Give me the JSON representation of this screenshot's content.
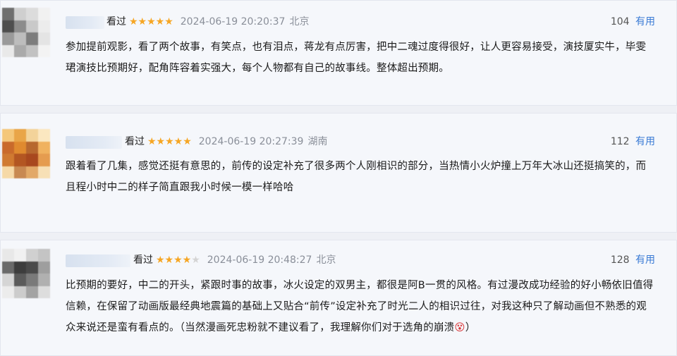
{
  "reviews": [
    {
      "watched_label": "看过",
      "stars": "★★★★★",
      "stars_empty": "",
      "datetime": "2024-06-19 20:20:37",
      "location": "北京",
      "useful_count": "104",
      "useful_label": "有用",
      "text": "参加提前观影，看了两个故事，有笑点，也有泪点，蒋龙有点厉害，把中二魂过度得很好，让人更容易接受，演技厦实牛，毕雯珺演技比预期好，配角阵容着实强大，每个人物都有自己的故事线。整体超出预期。",
      "avatar_colors": [
        "#6f6f6f",
        "#cfcfcf",
        "#dcdcdc",
        "#f1f1f1",
        "#4e4e4e",
        "#8c8c8c",
        "#c9c9c9",
        "#ececec",
        "#9a9a9a",
        "#bdbdbd",
        "#7d7d7d",
        "#e4e4e4",
        "#e9e9e9",
        "#aaaaaa",
        "#c2c2c2",
        "#f3f3f3"
      ]
    },
    {
      "watched_label": "看过",
      "stars": "★★★★★",
      "stars_empty": "",
      "datetime": "2024-06-19 20:27:39",
      "location": "湖南",
      "useful_count": "112",
      "useful_label": "有用",
      "text": "跟着看了几集，感觉还挺有意思的，前传的设定补充了很多两个人刚相识的部分，当热情小火炉撞上万年大冰山还挺搞笑的，而且程小时中二的样子简直跟我小时候一模一样哈哈",
      "avatar_colors": [
        "#f4c77a",
        "#e9a548",
        "#f3d39a",
        "#fbe7c0",
        "#c96a2b",
        "#e08a2f",
        "#b7682f",
        "#f0b25f",
        "#d07a31",
        "#b35622",
        "#a8481e",
        "#e59c4f",
        "#f6d9a7",
        "#c88952",
        "#e2a968",
        "#f7e0b6"
      ]
    },
    {
      "watched_label": "看过",
      "stars": "★★★★",
      "stars_empty": "★",
      "datetime": "2024-06-19 20:48:27",
      "location": "北京",
      "useful_count": "128",
      "useful_label": "有用",
      "text": "比预期的要好，中二的开头，紧跟时事的故事，冰火设定的双男主，都很是阿B一贯的风格。有过漫改成功经验的好小畅依旧值得信赖，在保留了动画版最经典地震篇的基础上又贴合“前传”设定补充了时光二人的相识过往，对我这种只了解动画但不熟悉的观众来说还是蛮有看点的。（当然漫画死忠粉就不建议看了，我理解你们对于选角的崩溃",
      "emoji": "😵",
      "text_end": "）",
      "avatar_colors": [
        "#e8e8e8",
        "#f1f1f1",
        "#d0d0d0",
        "#c4c4c4",
        "#6a6a6a",
        "#3d3d3d",
        "#4a4a4a",
        "#9e9e9e",
        "#d5d5d5",
        "#5b5b5b",
        "#7a7a7a",
        "#b0b0b0",
        "#ececec",
        "#cccccc",
        "#a3a3a3",
        "#dddddd"
      ]
    }
  ]
}
